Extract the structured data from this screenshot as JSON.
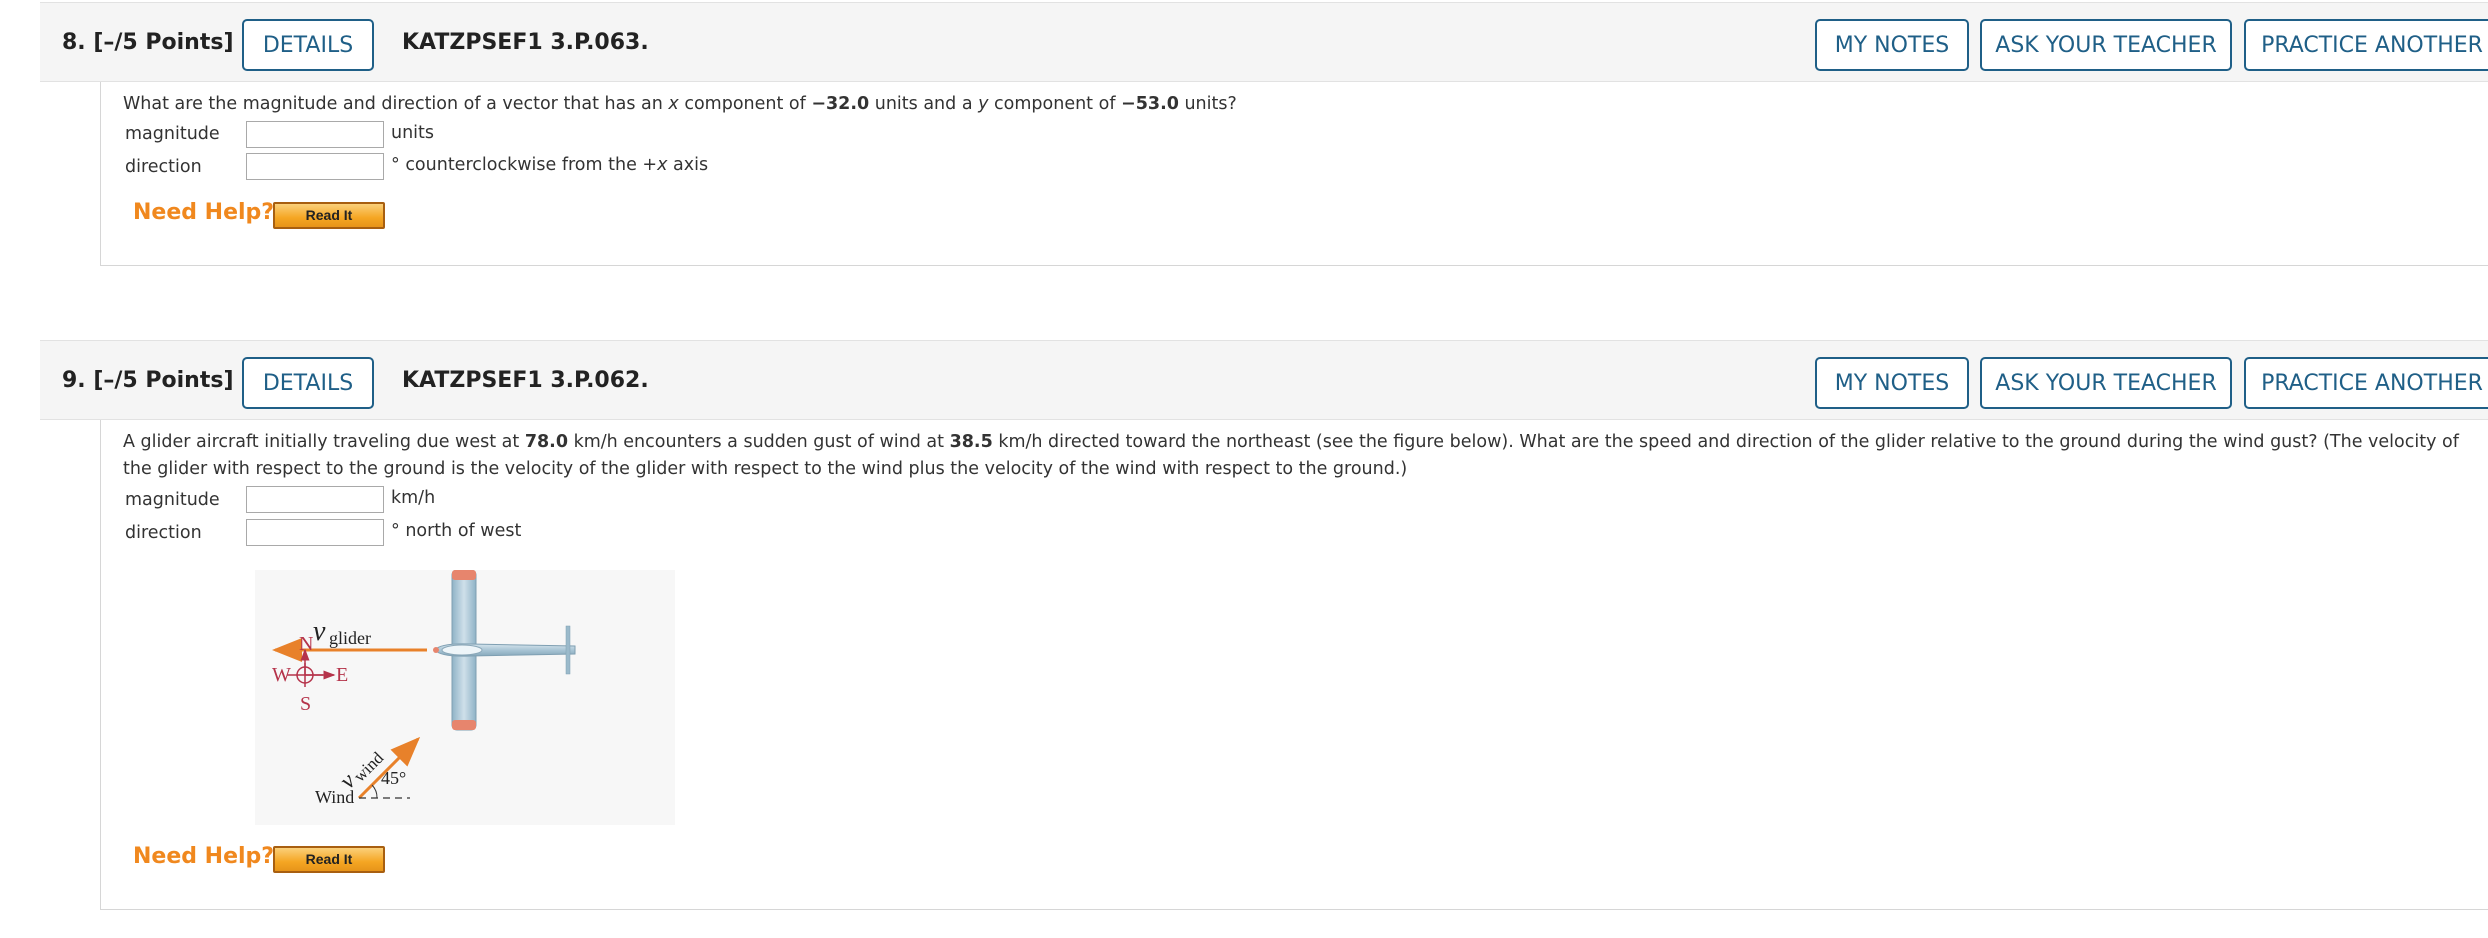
{
  "questions": [
    {
      "number": "8.",
      "points": "[–/5 Points]",
      "details_label": "DETAILS",
      "code": "KATZPSEF1 3.P.063.",
      "my_notes_label": "MY NOTES",
      "ask_teacher_label": "ASK YOUR TEACHER",
      "practice_label": "PRACTICE ANOTHER",
      "text_parts": [
        "What are the magnitude and direction of a vector that has an ",
        "x",
        " component of ",
        "−32.0",
        " units and a ",
        "y",
        " component of ",
        "−53.0",
        " units?"
      ],
      "rows": [
        {
          "label": "magnitude",
          "value": "",
          "unit": "units"
        },
        {
          "label": "direction",
          "value": "",
          "unit_parts": [
            "° counterclockwise from the +",
            "x",
            " axis"
          ]
        }
      ],
      "need_help": "Need Help?",
      "read_it": "Read It"
    },
    {
      "number": "9.",
      "points": "[–/5 Points]",
      "details_label": "DETAILS",
      "code": "KATZPSEF1 3.P.062.",
      "my_notes_label": "MY NOTES",
      "ask_teacher_label": "ASK YOUR TEACHER",
      "practice_label": "PRACTICE ANOTHER",
      "text_line1_parts": [
        "A glider aircraft initially traveling due west at ",
        "78.0",
        " km/h encounters a sudden gust of wind at ",
        "38.5",
        " km/h directed toward the northeast (see the figure below). What are the speed and direction of the glider relative to the ground during the wind gust? (The velocity of"
      ],
      "text_line2": "the glider with respect to the ground is the velocity of the glider with respect to the wind plus the velocity of the wind with respect to the ground.)",
      "rows": [
        {
          "label": "magnitude",
          "value": "",
          "unit": "km/h"
        },
        {
          "label": "direction",
          "value": "",
          "unit": "° north of west"
        }
      ],
      "figure": {
        "v_glider_symbol": "v",
        "v_glider_sub": "glider",
        "v_wind_symbol": "v",
        "v_wind_sub": "wind",
        "compass_n": "N",
        "compass_s": "S",
        "compass_e": "E",
        "compass_w": "W",
        "wind_label": "Wind",
        "angle_label": "45°"
      },
      "need_help": "Need Help?",
      "read_it": "Read It"
    }
  ],
  "colors": {
    "button_border": "#1f5f87",
    "need_help": "#f0881e",
    "arrow_orange": "#e8812a",
    "compass_red": "#b5334a"
  }
}
